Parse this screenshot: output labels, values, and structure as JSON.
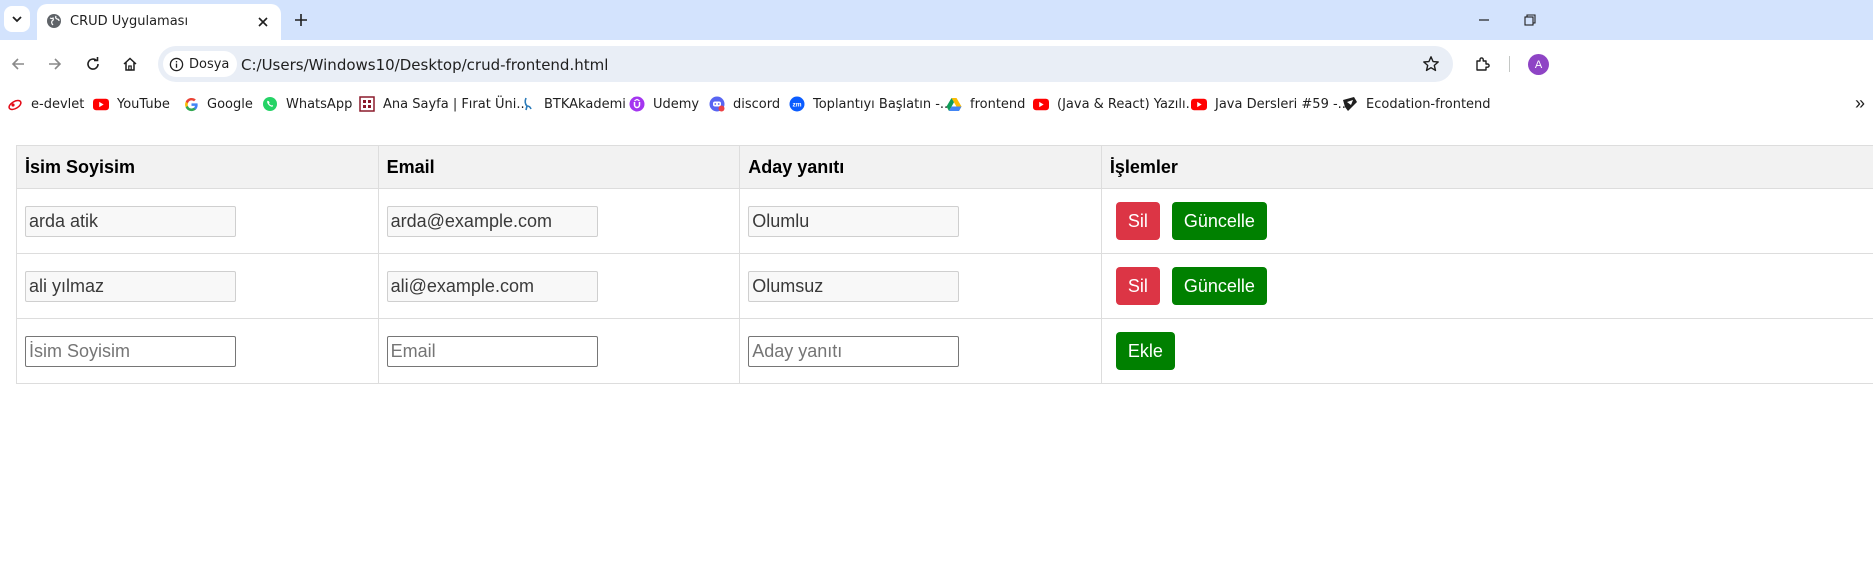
{
  "browser": {
    "tab": {
      "title": "CRUD Uygulaması"
    },
    "site_info_label": "Dosya",
    "url": "C:/Users/Windows10/Desktop/crud-frontend.html",
    "profile_initial": "A"
  },
  "bookmarks": [
    {
      "label": "e-devlet",
      "icon": "e-devlet-icon"
    },
    {
      "label": "YouTube",
      "icon": "youtube-icon"
    },
    {
      "label": "Google",
      "icon": "google-icon"
    },
    {
      "label": "WhatsApp",
      "icon": "whatsapp-icon"
    },
    {
      "label": "Ana Sayfa | Fırat Üni...",
      "icon": "firat-icon"
    },
    {
      "label": "BTKAkademi",
      "icon": "btk-icon"
    },
    {
      "label": "Udemy",
      "icon": "udemy-icon"
    },
    {
      "label": "discord",
      "icon": "discord-icon"
    },
    {
      "label": "Toplantıyı Başlatın -...",
      "icon": "zoom-icon"
    },
    {
      "label": "frontend",
      "icon": "drive-icon"
    },
    {
      "label": "(Java & React) Yazılı...",
      "icon": "youtube-icon"
    },
    {
      "label": "Java Dersleri #59 -...",
      "icon": "youtube-icon"
    },
    {
      "label": "Ecodation-frontend",
      "icon": "ecodation-icon"
    }
  ],
  "table": {
    "headers": [
      "İsim Soyisim",
      "Email",
      "Aday yanıtı",
      "İşlemler"
    ],
    "rows": [
      {
        "name": "arda atik",
        "email": "arda@example.com",
        "answer": "Olumlu"
      },
      {
        "name": "ali yılmaz",
        "email": "ali@example.com",
        "answer": "Olumsuz"
      }
    ],
    "new_row": {
      "name_placeholder": "İsim Soyisim",
      "email_placeholder": "Email",
      "answer_placeholder": "Aday yanıtı"
    },
    "actions": {
      "delete": "Sil",
      "update": "Güncelle",
      "add": "Ekle"
    }
  },
  "colors": {
    "delete": "#dc3545",
    "update": "#008000",
    "add": "#008000",
    "header_bg": "#f2f2f2"
  }
}
